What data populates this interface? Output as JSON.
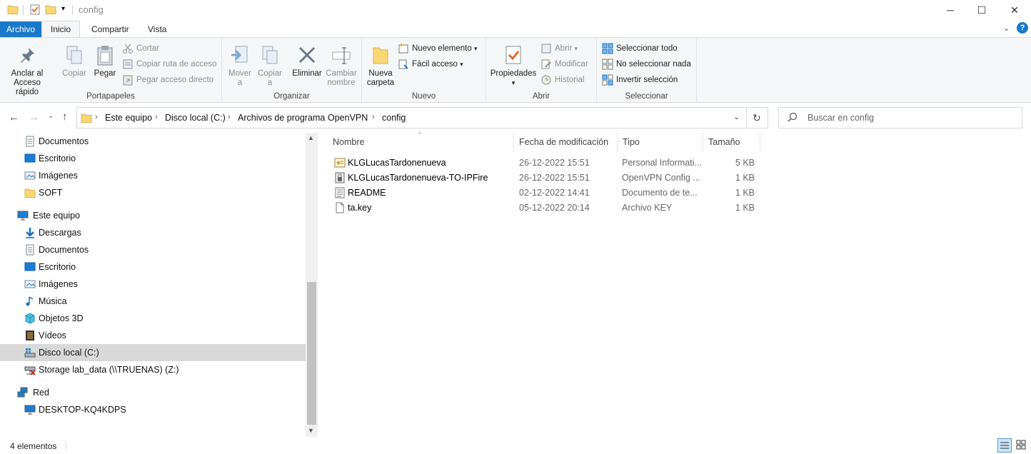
{
  "window": {
    "title": "config",
    "minimize": "─",
    "maximize": "☐",
    "close": "✕"
  },
  "tabs": [
    {
      "label": "Archivo"
    },
    {
      "label": "Inicio"
    },
    {
      "label": "Compartir"
    },
    {
      "label": "Vista"
    }
  ],
  "ribbon": {
    "portapapeles": {
      "label": "Portapapeles",
      "pin_line1": "Anclar al",
      "pin_line2": "Acceso rápido",
      "copy": "Copiar",
      "paste": "Pegar",
      "cut": "Cortar",
      "copy_path": "Copiar ruta de acceso",
      "paste_shortcut": "Pegar acceso directo"
    },
    "organizar": {
      "label": "Organizar",
      "move_line1": "Mover",
      "move_line2": "a",
      "copy_line1": "Copiar",
      "copy_line2": "a",
      "delete": "Eliminar",
      "rename_line1": "Cambiar",
      "rename_line2": "nombre"
    },
    "nuevo": {
      "label": "Nuevo",
      "folder_line1": "Nueva",
      "folder_line2": "carpeta",
      "new_item": "Nuevo elemento",
      "easy_access": "Fácil acceso"
    },
    "abrir": {
      "label": "Abrir",
      "properties": "Propiedades",
      "open": "Abrir",
      "edit": "Modificar",
      "history": "Historial"
    },
    "seleccionar": {
      "label": "Seleccionar",
      "select_all": "Seleccionar todo",
      "select_none": "No seleccionar nada",
      "invert": "Invertir selección"
    }
  },
  "address": {
    "crumbs": [
      "Este equipo",
      "Disco local (C:)",
      "Archivos de programa",
      "OpenVPN",
      "config"
    ],
    "search_placeholder": "Buscar en config"
  },
  "nav": {
    "items": [
      {
        "label": "Documentos",
        "icon": "documents-icon"
      },
      {
        "label": "Escritorio",
        "icon": "desktop-icon"
      },
      {
        "label": "Imágenes",
        "icon": "pictures-icon"
      },
      {
        "label": "SOFT",
        "icon": "folder-icon"
      },
      {
        "label": "Este equipo",
        "icon": "computer-icon"
      },
      {
        "label": "Descargas",
        "icon": "downloads-icon"
      },
      {
        "label": "Documentos",
        "icon": "documents-icon"
      },
      {
        "label": "Escritorio",
        "icon": "desktop-icon"
      },
      {
        "label": "Imágenes",
        "icon": "pictures-icon"
      },
      {
        "label": "Música",
        "icon": "music-icon"
      },
      {
        "label": "Objetos 3D",
        "icon": "objects-3d-icon"
      },
      {
        "label": "Vídeos",
        "icon": "videos-icon"
      },
      {
        "label": "Disco local (C:)",
        "icon": "drive-icon"
      },
      {
        "label": "Storage lab_data (\\\\TRUENAS) (Z:)",
        "icon": "network-drive-icon"
      },
      {
        "label": "Red",
        "icon": "network-icon"
      },
      {
        "label": "DESKTOP-KQ4KDPS",
        "icon": "computer-icon"
      }
    ]
  },
  "columns": {
    "name": "Nombre",
    "date": "Fecha de modificación",
    "type": "Tipo",
    "size": "Tamaño"
  },
  "files": [
    {
      "name": "KLGLucasTardonenueva",
      "date": "26-12-2022 15:51",
      "type": "Personal Informati...",
      "size": "5 KB",
      "icon": "certificate-icon"
    },
    {
      "name": "KLGLucasTardonenueva-TO-IPFire",
      "date": "26-12-2022 15:51",
      "type": "OpenVPN Config ...",
      "size": "1 KB",
      "icon": "openvpn-config-icon"
    },
    {
      "name": "README",
      "date": "02-12-2022 14:41",
      "type": "Documento de te...",
      "size": "1 KB",
      "icon": "text-file-icon"
    },
    {
      "name": "ta.key",
      "date": "05-12-2022 20:14",
      "type": "Archivo KEY",
      "size": "1 KB",
      "icon": "file-icon"
    }
  ],
  "status": {
    "count": "4 elementos"
  },
  "colors": {
    "accent": "#1979ca",
    "selection": "#d9d9d9"
  }
}
